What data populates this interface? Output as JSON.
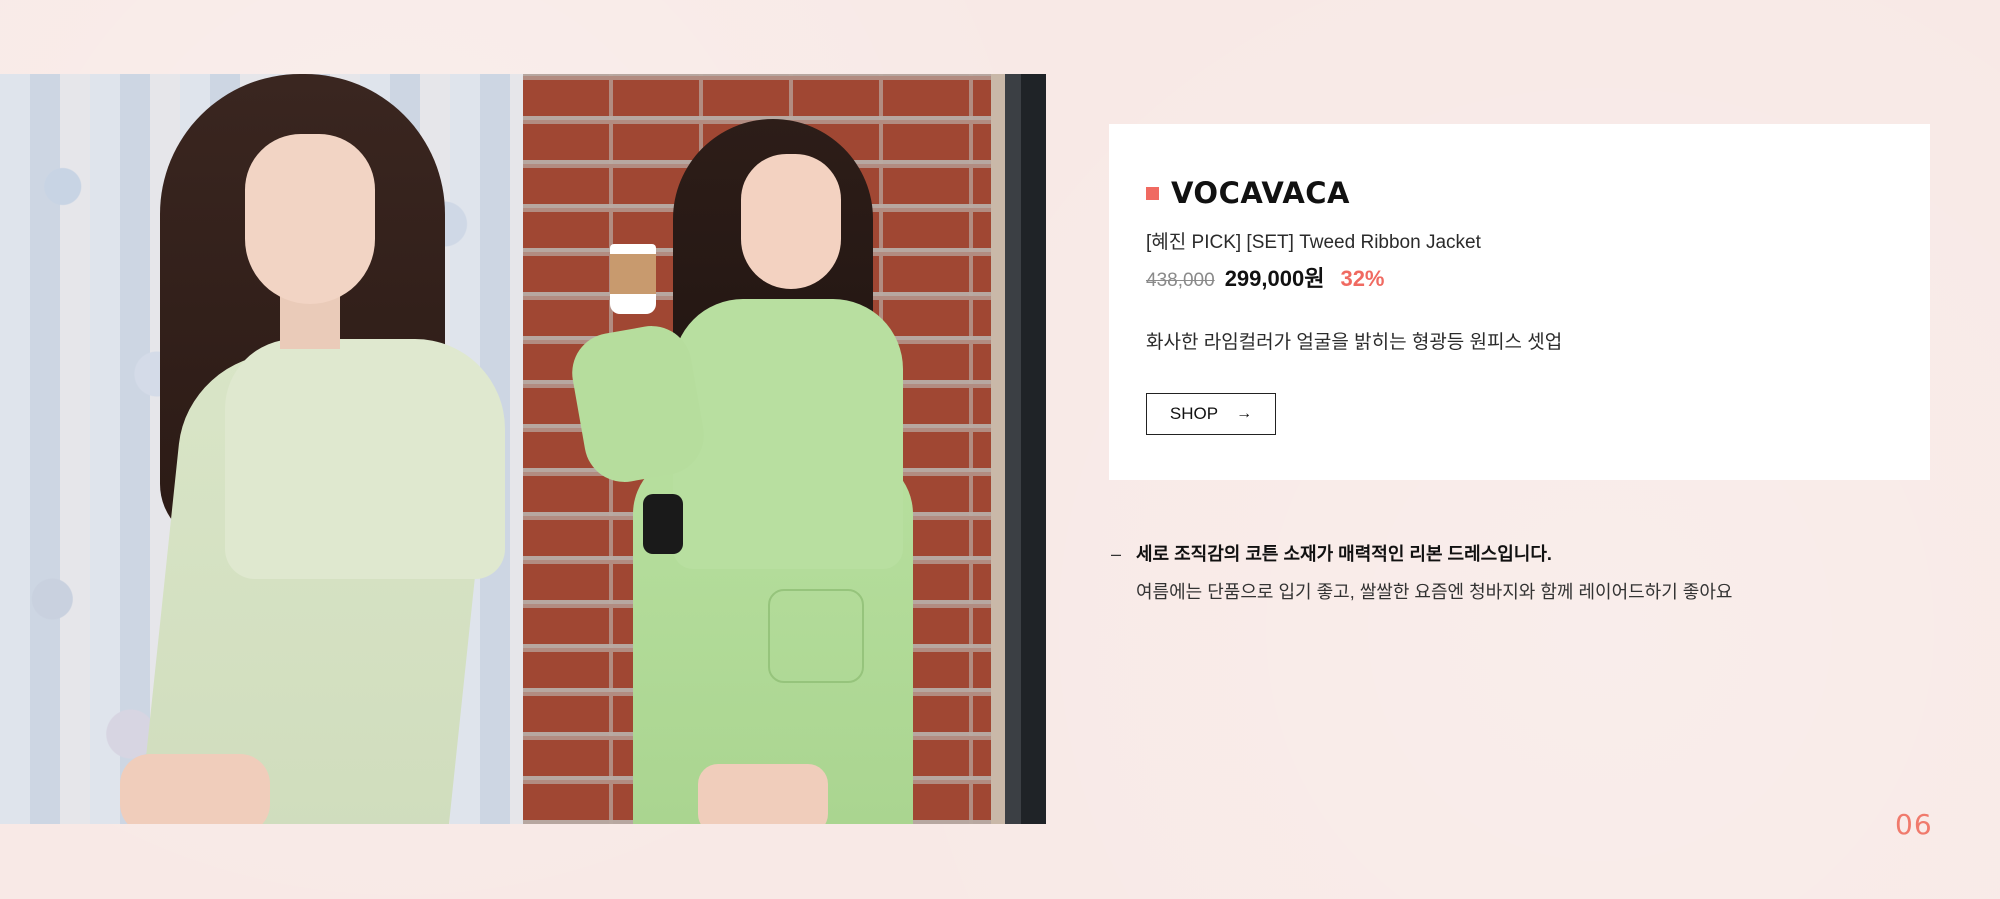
{
  "brand": {
    "name": "VOCAVACA",
    "accent_color": "#f06a61"
  },
  "product": {
    "name": "[혜진 PICK] [SET] Tweed Ribbon Jacket",
    "original_price": "438,000",
    "sale_price": "299,000원",
    "discount": "32%",
    "tagline": "화사한 라임컬러가 얼굴을 밝히는 형광등 원피스 셋업"
  },
  "actions": {
    "shop_label": "SHOP",
    "shop_icon": "arrow-right-icon"
  },
  "description": {
    "dash": "–",
    "headline": "세로 조직감의 코튼 소재가 매력적인 리본 드레스입니다.",
    "detail": "여름에는 단품으로 입기 좋고, 쌀쌀한 요즘엔 청바지와 함께 레이어드하기 좋아요"
  },
  "slide": {
    "number": "06"
  },
  "photos": [
    {
      "subject": "model-seated-lime-dress"
    },
    {
      "subject": "model-lime-jacket-set-brick-wall"
    }
  ]
}
